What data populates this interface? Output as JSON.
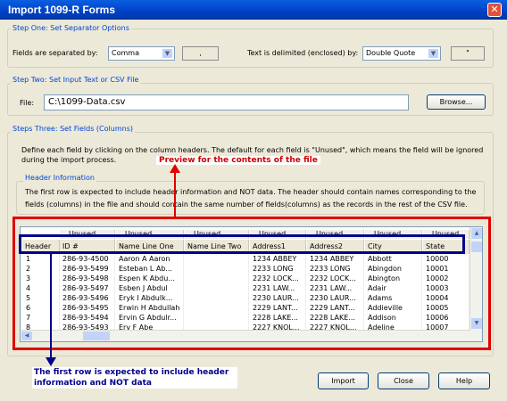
{
  "window": {
    "title": "Import 1099-R Forms"
  },
  "step1": {
    "legend": "Step One: Set Separator Options",
    "sep_label": "Fields are separated by:",
    "sep_value": "Comma",
    "sep_char": ",",
    "delim_label": "Text is delimited (enclosed) by:",
    "delim_value": "Double Quote",
    "delim_char": "\""
  },
  "step2": {
    "legend": "Step Two: Set Input Text or CSV File",
    "file_label": "File:",
    "file_value": "C:\\1099-Data.csv",
    "browse_label": "Browse..."
  },
  "step3": {
    "legend": "Steps Three: Set Fields (Columns)",
    "description": "Define each field by clicking on the column headers. The default for each field is \"Unused\", which means the field will be ignored during the import process.",
    "header_info_legend": "Header Information",
    "header_info_text": "The first row is expected to include header information and NOT data. The header should contain names corresponding to the fields (columns) in the file and should contain the same number of fields(columns) as the records in the rest of the CSV file."
  },
  "annotations": {
    "preview": "Preview for the contents of the file",
    "first_row": "The first row is expected to include header information and NOT data"
  },
  "grid": {
    "unused_label": "Unused",
    "headers": [
      "Header",
      "ID #",
      "Name Line One",
      "Name Line Two",
      "Address1",
      "Address2",
      "City",
      "State"
    ],
    "rows": [
      [
        "1",
        "286-93-4500",
        "Aaron A  Aaron",
        "",
        "1234  ABBEY",
        "1234  ABBEY",
        "Abbott",
        "10000"
      ],
      [
        "2",
        "286-93-5499",
        "Esteban  L  Ab...",
        "",
        "2233  LONG",
        "2233  LONG",
        "Abingdon",
        "10001"
      ],
      [
        "3",
        "286-93-5498",
        "Espen K  Abdu...",
        "",
        "2232  LOCK...",
        "2232  LOCK...",
        "Abington",
        "10002"
      ],
      [
        "4",
        "286-93-5497",
        "Esben  J  Abdul",
        "",
        "2231  LAW...",
        "2231  LAW...",
        "Adair",
        "10003"
      ],
      [
        "5",
        "286-93-5496",
        "Eryk  I  Abdulk...",
        "",
        "2230  LAUR...",
        "2230  LAUR...",
        "Adams",
        "10004"
      ],
      [
        "6",
        "286-93-5495",
        "Erwin H  Abdullah",
        "",
        "2229  LANT...",
        "2229  LANT...",
        "Addieville",
        "10005"
      ],
      [
        "7",
        "286-93-5494",
        "Ervin G  Abdulr...",
        "",
        "2228  LAKE...",
        "2228  LAKE...",
        "Addison",
        "10006"
      ],
      [
        "8",
        "286-93-5493",
        "Erv  F  Abe",
        "",
        "2227  KNOL...",
        "2227  KNOL...",
        "Adeline",
        "10007"
      ]
    ]
  },
  "buttons": {
    "import": "Import",
    "close": "Close",
    "help": "Help"
  },
  "colors": {
    "title_bar": "#0041c8",
    "annotation_red": "#e00000",
    "annotation_blue": "#00008b"
  }
}
